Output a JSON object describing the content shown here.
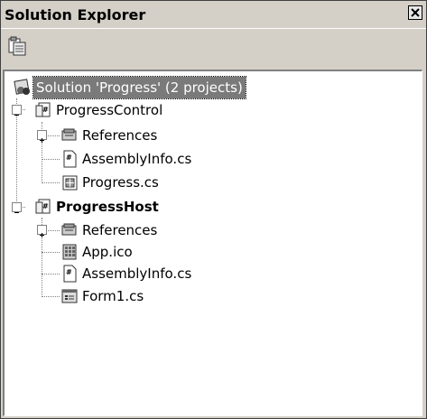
{
  "window": {
    "title": "Solution Explorer"
  },
  "toolbar": {
    "properties_button_icon": "properties-icon"
  },
  "tree": {
    "solution": {
      "label": "Solution 'Progress' (2 projects)",
      "icon": "solution-icon"
    },
    "projects": [
      {
        "label": "ProgressControl",
        "bold": false,
        "items": [
          {
            "label": "References",
            "icon": "references-icon",
            "expandable": true
          },
          {
            "label": "AssemblyInfo.cs",
            "icon": "cs-file-icon"
          },
          {
            "label": "Progress.cs",
            "icon": "user-control-icon"
          }
        ]
      },
      {
        "label": "ProgressHost",
        "bold": true,
        "items": [
          {
            "label": "References",
            "icon": "references-icon",
            "expandable": true
          },
          {
            "label": "App.ico",
            "icon": "ico-file-icon"
          },
          {
            "label": "AssemblyInfo.cs",
            "icon": "cs-file-icon"
          },
          {
            "label": "Form1.cs",
            "icon": "form-icon"
          }
        ]
      }
    ]
  }
}
